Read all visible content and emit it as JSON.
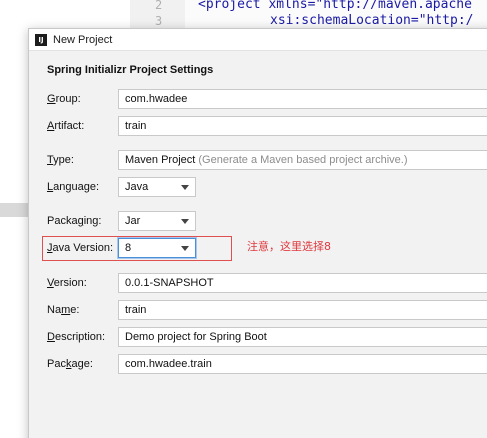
{
  "editor": {
    "line_numbers": [
      "2",
      "3"
    ],
    "line2_text": "<project xmlns=\"http://maven.apache",
    "line3_text": "xsi:schemaLocation=\"http:/"
  },
  "dialog": {
    "title": "New Project",
    "app_icon": "intellij-icon",
    "section_title": "Spring Initializr Project Settings"
  },
  "form": {
    "group": {
      "label_pre": "",
      "label_u": "G",
      "label_post": "roup:",
      "value": "com.hwadee"
    },
    "artifact": {
      "label_pre": "",
      "label_u": "A",
      "label_post": "rtifact:",
      "value": "train"
    },
    "type": {
      "label_pre": "",
      "label_u": "T",
      "label_post": "ype:",
      "value": "Maven Project",
      "hint": "(Generate a Maven based project archive.)"
    },
    "language": {
      "label_pre": "",
      "label_u": "L",
      "label_post": "anguage:",
      "value": "Java"
    },
    "packaging": {
      "label_pre": "Packa",
      "label_u": "g",
      "label_post": "ing:",
      "value": "Jar"
    },
    "java_version": {
      "label_pre": "",
      "label_u": "J",
      "label_post": "ava Version:",
      "value": "8"
    },
    "version": {
      "label_pre": "",
      "label_u": "V",
      "label_post": "ersion:",
      "value": "0.0.1-SNAPSHOT"
    },
    "name": {
      "label_pre": "Na",
      "label_u": "m",
      "label_post": "e:",
      "value": "train"
    },
    "description": {
      "label_pre": "",
      "label_u": "D",
      "label_post": "escription:",
      "value": "Demo project for Spring Boot"
    },
    "package": {
      "label_pre": "Pac",
      "label_u": "k",
      "label_post": "age:",
      "value": "com.hwadee.train"
    }
  },
  "annotation": {
    "note": "注意，这里选择8",
    "color": "#e0393e"
  }
}
